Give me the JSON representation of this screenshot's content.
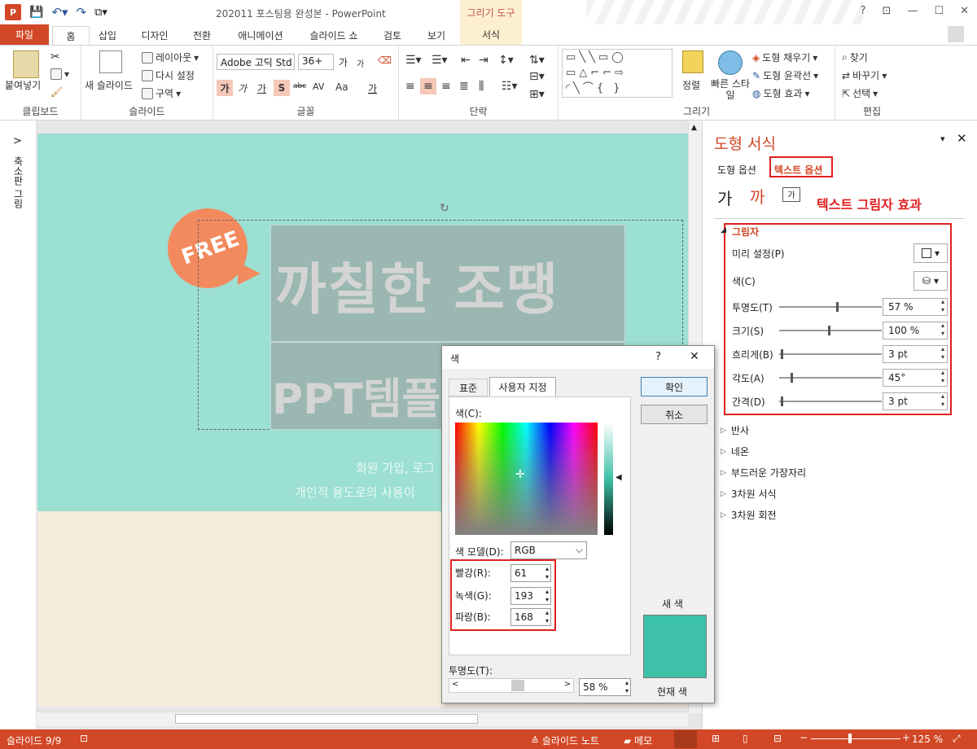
{
  "titlebar": {
    "title": "202011 포스팅용 완성본 - PowerPoint",
    "app_icon": "P",
    "context_tools": "그리기 도구",
    "help": "?",
    "restore": "⊡",
    "minimize": "—",
    "maximize": "☐",
    "close": "✕"
  },
  "tabs": {
    "file": "파일",
    "home": "홈",
    "insert": "삽입",
    "design": "디자인",
    "transitions": "전환",
    "animations": "애니메이션",
    "slideshow": "슬라이드 쇼",
    "review": "검토",
    "view": "보기",
    "format": "서식"
  },
  "ribbon": {
    "clipboard": {
      "label": "클립보드",
      "paste": "붙여넣기"
    },
    "slides": {
      "label": "슬라이드",
      "new_slide": "새 슬라이드",
      "layout": "레이아웃",
      "reset": "다시 설정",
      "section": "구역"
    },
    "font": {
      "label": "글꼴",
      "font_name": "Adobe 고딕 Std",
      "font_size": "36+",
      "inc": "가",
      "dec": "가",
      "bold": "가",
      "italic": "가",
      "underline": "가",
      "shadow": "S",
      "strike": "abc",
      "spacing": "AV",
      "case": "Aa",
      "color": "가"
    },
    "paragraph": {
      "label": "단락"
    },
    "drawing": {
      "label": "그리기",
      "arrange": "정렬",
      "quick_styles": "빠른 스타일",
      "fill": "도형 채우기",
      "outline": "도형 윤곽선",
      "effects": "도형 효과"
    },
    "editing": {
      "label": "편집",
      "find": "찾기",
      "replace": "바꾸기",
      "select": "선택"
    }
  },
  "leftcol": {
    "label": "축소판 그림",
    "toggle": ">"
  },
  "slide": {
    "badge": "FREE",
    "title_line1": "까칠한 조땡",
    "title_line2": "PPT템플",
    "sub1": "회원 가입, 로그",
    "sub2": "개인적 용도로의 사용이"
  },
  "pane": {
    "title": "도형 서식",
    "tab_shape": "도형 옵션",
    "tab_text": "텍스트 옵션",
    "annotation": "텍스트 그림자 효과",
    "shadow": {
      "header": "그림자",
      "preset": "미리 설정(P)",
      "color": "색(C)",
      "transparency": "투명도(T)",
      "transparency_val": "57 %",
      "size": "크기(S)",
      "size_val": "100 %",
      "blur": "흐리게(B)",
      "blur_val": "3 pt",
      "angle": "각도(A)",
      "angle_val": "45°",
      "distance": "간격(D)",
      "distance_val": "3 pt"
    },
    "sections": [
      "반사",
      "네온",
      "부드러운 가장자리",
      "3차원 서식",
      "3차원 회전"
    ]
  },
  "dialog": {
    "title": "색",
    "help": "?",
    "close": "✕",
    "tab_standard": "표준",
    "tab_custom": "사용자 지정",
    "colors_label": "색(C):",
    "model_label": "색 모델(D):",
    "model_value": "RGB",
    "red_label": "빨강(R):",
    "red": "61",
    "green_label": "녹색(G):",
    "green": "193",
    "blue_label": "파랑(B):",
    "blue": "168",
    "alpha_label": "투명도(T):",
    "alpha": "58 %",
    "ok": "확인",
    "cancel": "취소",
    "new_label": "새 색",
    "current_label": "현재 색",
    "new_color": "#3dc1a8"
  },
  "status": {
    "slide": "슬라이드 9/9",
    "notes": "슬라이드 노트",
    "comments": "메모",
    "zoom": "125 %",
    "zoom_minus": "−",
    "zoom_plus": "+"
  }
}
